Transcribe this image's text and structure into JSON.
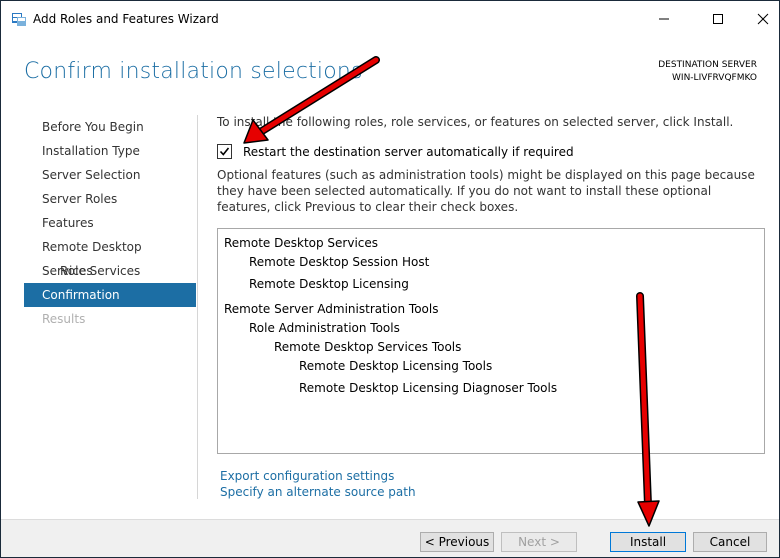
{
  "window": {
    "title": "Add Roles and Features Wizard"
  },
  "header": {
    "title": "Confirm installation selections",
    "destination_label": "DESTINATION SERVER",
    "destination_server": "WIN-LIVFRVQFMKO"
  },
  "sidebar": {
    "items": [
      {
        "label": "Before You Begin",
        "state": "normal"
      },
      {
        "label": "Installation Type",
        "state": "normal"
      },
      {
        "label": "Server Selection",
        "state": "normal"
      },
      {
        "label": "Server Roles",
        "state": "normal"
      },
      {
        "label": "Features",
        "state": "normal"
      },
      {
        "label": "Remote Desktop Services",
        "state": "normal"
      },
      {
        "label": "Role Services",
        "state": "sub"
      },
      {
        "label": "Confirmation",
        "state": "active"
      },
      {
        "label": "Results",
        "state": "disabled"
      }
    ]
  },
  "main": {
    "intro": "To install the following roles, role services, or features on selected server, click Install.",
    "restart_label": "Restart the destination server automatically if required",
    "restart_checked": true,
    "optional_text": "Optional features (such as administration tools) might be displayed on this page because they have been selected automatically. If you do not want to install these optional features, click Previous to clear their check boxes.",
    "selections": [
      {
        "text": "Remote Desktop Services",
        "level": 0
      },
      {
        "text": "Remote Desktop Session Host",
        "level": 1
      },
      {
        "text": "Remote Desktop Licensing",
        "level": 1
      },
      {
        "text": "Remote Server Administration Tools",
        "level": 0
      },
      {
        "text": "Role Administration Tools",
        "level": 1
      },
      {
        "text": "Remote Desktop Services Tools",
        "level": 2
      },
      {
        "text": "Remote Desktop Licensing Tools",
        "level": 3
      },
      {
        "text": "Remote Desktop Licensing Diagnoser Tools",
        "level": 3
      }
    ],
    "export_link": "Export configuration settings",
    "alt_source_link": "Specify an alternate source path"
  },
  "footer": {
    "previous_label": "< Previous",
    "next_label": "Next >",
    "install_label": "Install",
    "cancel_label": "Cancel"
  },
  "colors": {
    "accent": "#1c6ea4",
    "annotation_arrow": "#e60000"
  }
}
